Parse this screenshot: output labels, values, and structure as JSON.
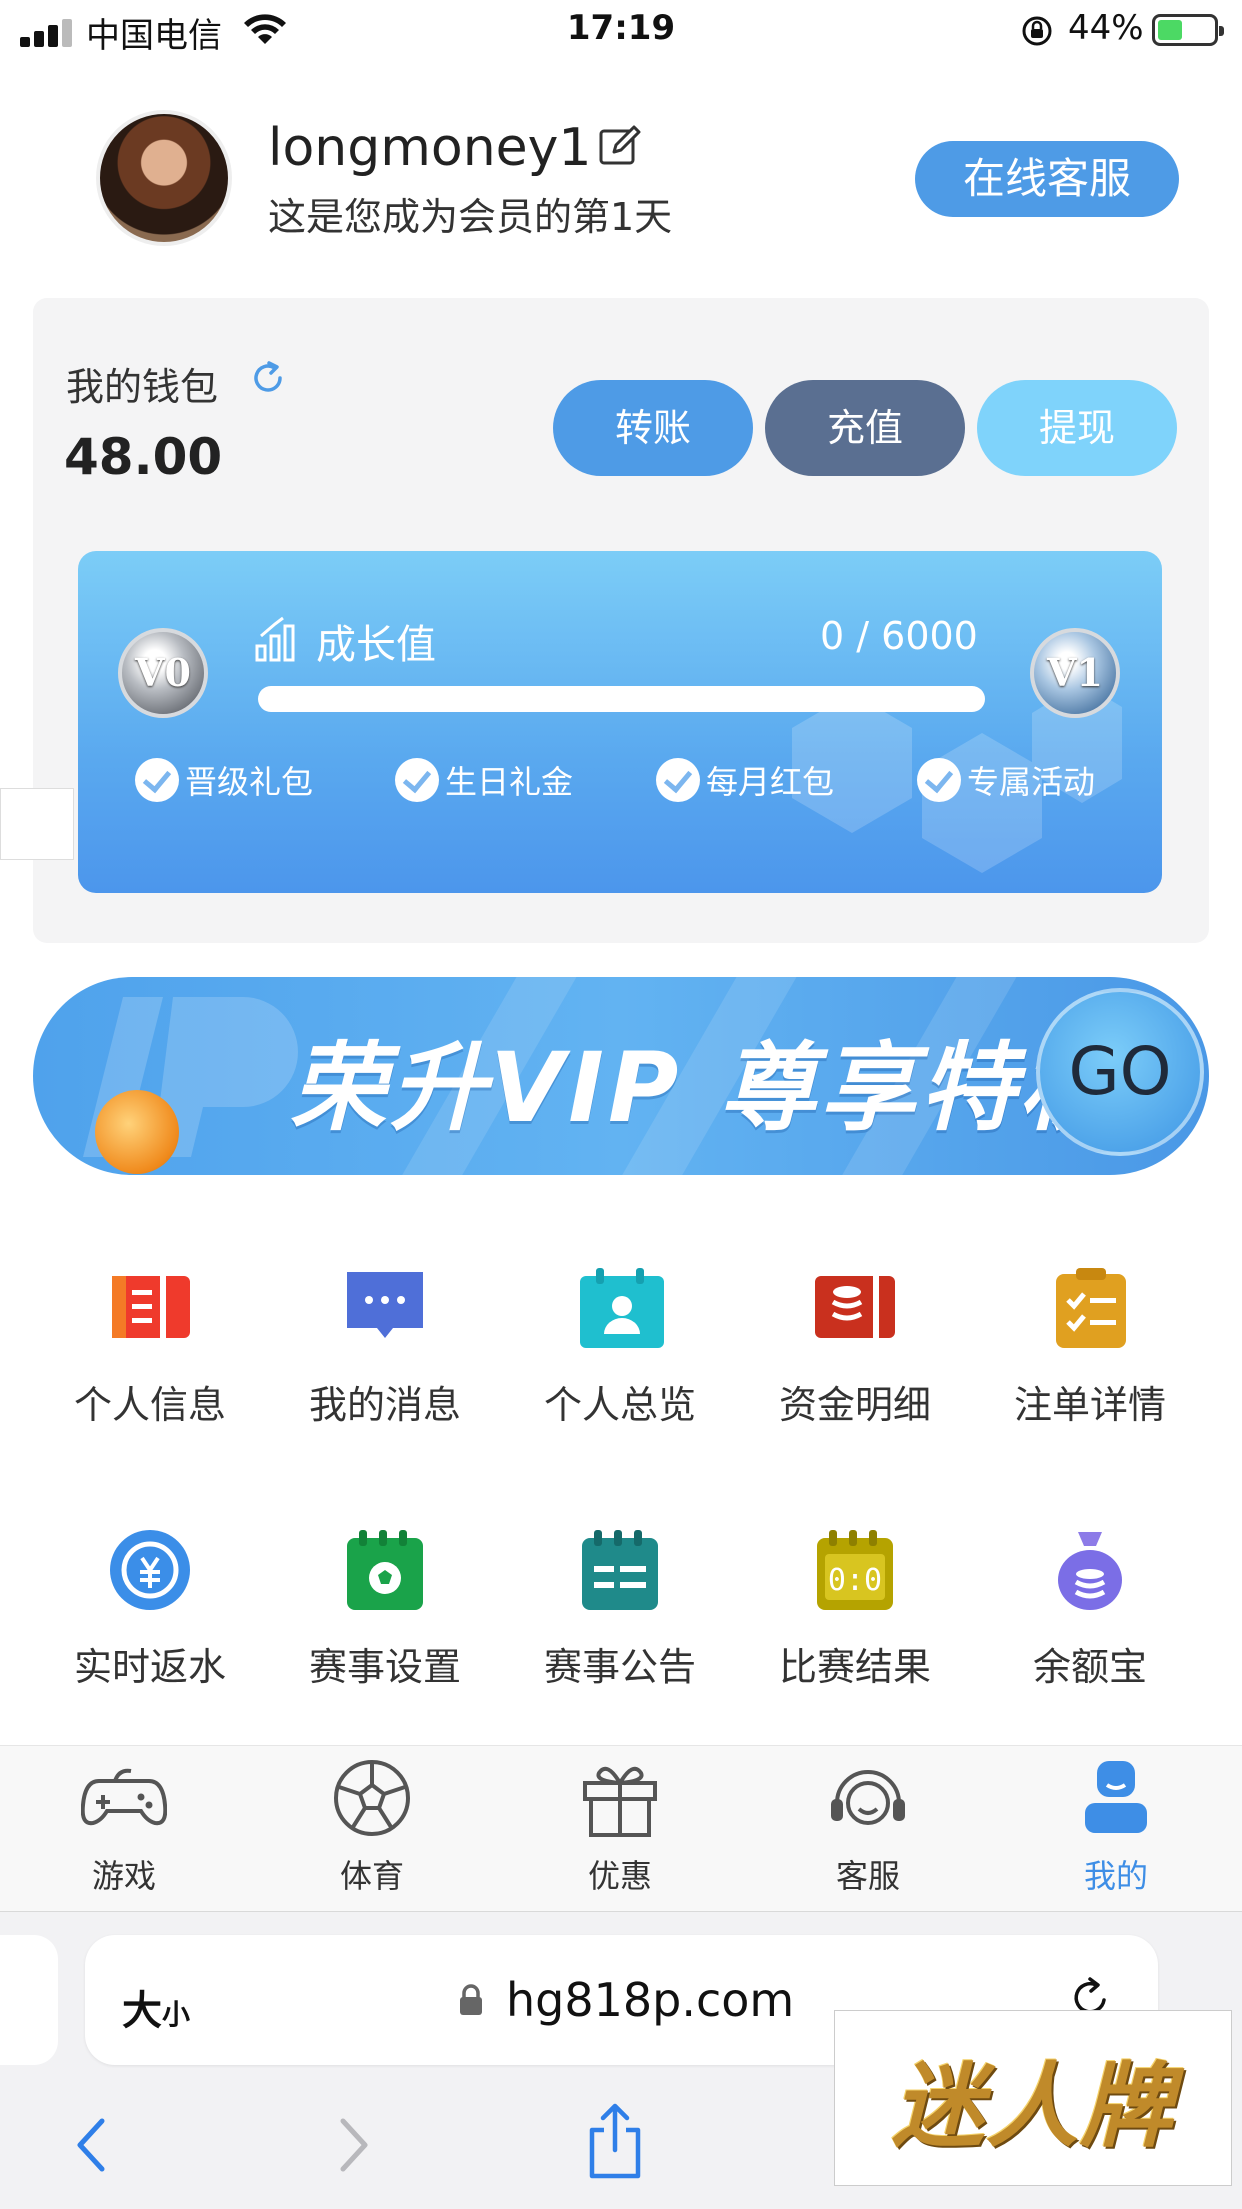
{
  "status_bar": {
    "carrier": "中国电信",
    "time": "17:19",
    "battery_percent": "44%",
    "battery_level": 0.44
  },
  "profile": {
    "username": "longmoney1",
    "member_days": "这是您成为会员的第1天",
    "service_button": "在线客服"
  },
  "wallet": {
    "label": "我的钱包",
    "balance": "48.00",
    "buttons": {
      "transfer": "转账",
      "recharge": "充值",
      "withdraw": "提现"
    }
  },
  "vip": {
    "current_level": "V0",
    "next_level": "V1",
    "growth_label": "成长值",
    "growth_value": "0 / 6000",
    "progress": 0.0,
    "perks": [
      "晋级礼包",
      "生日礼金",
      "每月红包",
      "专属活动"
    ]
  },
  "banner": {
    "text": "荣升VIP 尊享特权",
    "go": "GO"
  },
  "menu": [
    {
      "label": "个人信息",
      "icon": "id-card-icon"
    },
    {
      "label": "我的消息",
      "icon": "message-icon"
    },
    {
      "label": "个人总览",
      "icon": "profile-calendar-icon"
    },
    {
      "label": "资金明细",
      "icon": "database-icon"
    },
    {
      "label": "注单详情",
      "icon": "clipboard-icon"
    },
    {
      "label": "实时返水",
      "icon": "rebate-icon"
    },
    {
      "label": "赛事设置",
      "icon": "calendar-ball-icon"
    },
    {
      "label": "赛事公告",
      "icon": "announcement-icon"
    },
    {
      "label": "比赛结果",
      "icon": "scoreboard-icon"
    },
    {
      "label": "余额宝",
      "icon": "money-bag-icon"
    }
  ],
  "tabbar": [
    {
      "label": "游戏",
      "icon": "gamepad-icon"
    },
    {
      "label": "体育",
      "icon": "soccer-ball-icon"
    },
    {
      "label": "优惠",
      "icon": "gift-icon"
    },
    {
      "label": "客服",
      "icon": "headset-icon"
    },
    {
      "label": "我的",
      "icon": "user-icon",
      "active": true
    }
  ],
  "browser": {
    "text_size": "大",
    "text_size_small": "小",
    "url": "hg818p.com"
  },
  "watermark": "迷人牌",
  "colors": {
    "primary": "#4e9be6",
    "recharge": "#5a6f91",
    "withdraw": "#7fd3fb",
    "active_tab": "#3e8ee6"
  }
}
